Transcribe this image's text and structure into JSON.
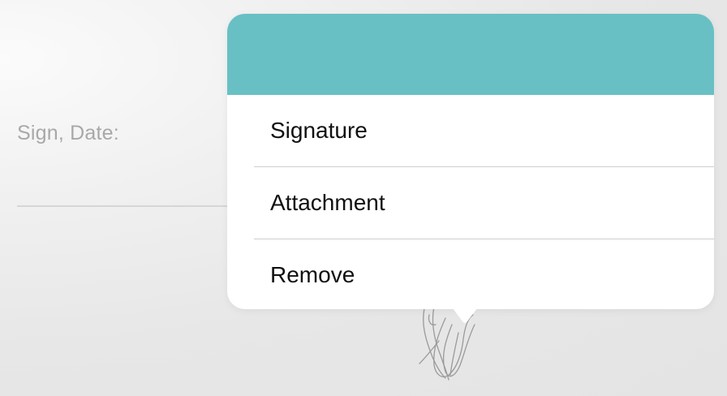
{
  "form": {
    "sign_date_label": "Sign, Date:"
  },
  "popover": {
    "header_color": "#68c0c4",
    "menu_items": [
      {
        "label": "Signature"
      },
      {
        "label": "Attachment"
      },
      {
        "label": "Remove"
      }
    ]
  }
}
